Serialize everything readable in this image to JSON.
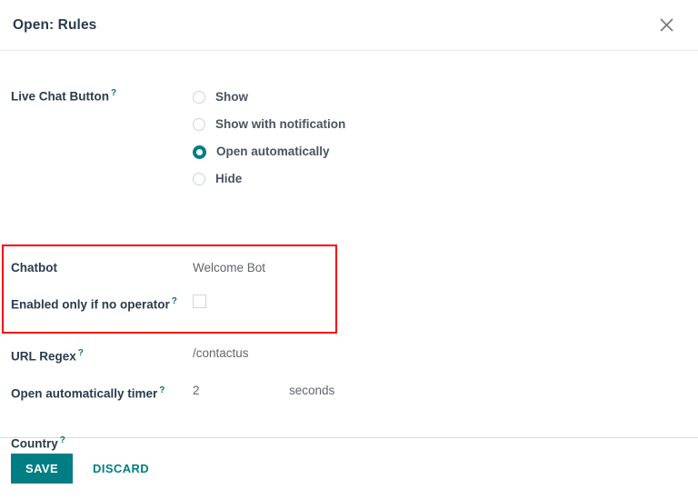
{
  "dialog": {
    "title": "Open: Rules",
    "close_icon": "close-icon"
  },
  "form": {
    "live_chat_button": {
      "label": "Live Chat Button",
      "help": "?",
      "options": [
        {
          "label": "Show",
          "selected": false
        },
        {
          "label": "Show with notification",
          "selected": false
        },
        {
          "label": "Open automatically",
          "selected": true
        },
        {
          "label": "Hide",
          "selected": false
        }
      ]
    },
    "chatbot": {
      "label": "Chatbot",
      "value": "Welcome Bot"
    },
    "enabled_only_if_no_operator": {
      "label": "Enabled only if no operator",
      "help": "?",
      "checked": false
    },
    "url_regex": {
      "label": "URL Regex",
      "help": "?",
      "value": "/contactus"
    },
    "open_automatically_timer": {
      "label": "Open automatically timer",
      "help": "?",
      "value": "2",
      "unit": "seconds"
    },
    "country": {
      "label": "Country",
      "help": "?",
      "value": ""
    }
  },
  "footer": {
    "save_label": "SAVE",
    "discard_label": "DISCARD"
  },
  "colors": {
    "accent_teal": "#017e84",
    "highlight_red": "#ff0000",
    "label_text": "#2a3c4e",
    "value_text": "#62656b",
    "help_mark": "#0f6d78"
  }
}
